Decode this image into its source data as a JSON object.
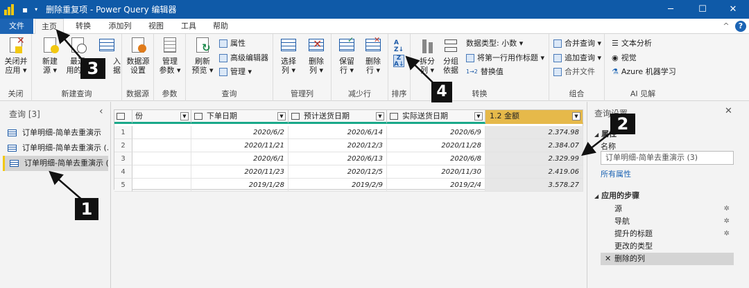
{
  "window": {
    "title": "删除重复项 - Power Query 编辑器",
    "minimize": "─",
    "maximize": "☐",
    "close": "✕"
  },
  "tabs": [
    "文件",
    "主页",
    "转换",
    "添加列",
    "视图",
    "工具",
    "帮助"
  ],
  "ribbon": {
    "close_group": {
      "label": "关闭",
      "btn": "关闭并\n应用 ▾"
    },
    "newquery_group": {
      "label": "新建查询",
      "new_source": "新建\n源 ▾",
      "recent": "最近\n用的源",
      "enter": "入\n据"
    },
    "datasource_group": {
      "label": "数据源",
      "btn": "数据源\n设置"
    },
    "params_group": {
      "label": "参数",
      "btn": "管理\n参数 ▾"
    },
    "query_group": {
      "label": "查询",
      "refresh": "刷新\n预览 ▾",
      "properties": "属性",
      "advanced": "高级编辑器",
      "manage": "管理 ▾"
    },
    "managecols_group": {
      "label": "管理列",
      "choose": "选择\n列 ▾",
      "remove": "删除\n列 ▾"
    },
    "reducerows_group": {
      "label": "减少行",
      "keep": "保留\n行 ▾",
      "remove": "删除\n行 ▾"
    },
    "sort_group": {
      "label": "排序"
    },
    "transform_group": {
      "label": "转换",
      "split": "拆分\n列 ▾",
      "groupby": "分组\n依据",
      "datatype": "数据类型: 小数 ▾",
      "first_row": "将第一行用作标题 ▾",
      "replace": "替换值"
    },
    "combine_group": {
      "label": "组合",
      "merge": "合并查询 ▾",
      "append": "追加查询 ▾",
      "merge_files": "合并文件"
    },
    "ai_group": {
      "label": "AI 见解",
      "text": "文本分析",
      "vision": "视觉",
      "azure": "Azure 机器学习"
    }
  },
  "left_pane": {
    "title": "查询 [3]",
    "collapse": "‹",
    "queries": [
      "订单明细-简单去重演示",
      "订单明细-简单去重演示 (...",
      "订单明细-简单去重演示 (..."
    ]
  },
  "grid": {
    "columns": [
      "份",
      "下单日期",
      "预计送货日期",
      "实际送货日期",
      "1.2  金额"
    ],
    "rows": [
      {
        "n": "1",
        "d1": "2020/6/2",
        "d2": "2020/6/14",
        "d3": "2020/6/9",
        "amt": "2.374.98"
      },
      {
        "n": "2",
        "d1": "2020/11/21",
        "d2": "2020/12/3",
        "d3": "2020/11/28",
        "amt": "2.384.07"
      },
      {
        "n": "3",
        "d1": "2020/6/1",
        "d2": "2020/6/13",
        "d3": "2020/6/8",
        "amt": "2.329.99"
      },
      {
        "n": "4",
        "d1": "2020/11/23",
        "d2": "2020/12/5",
        "d3": "2020/11/30",
        "amt": "2.419.06"
      },
      {
        "n": "5",
        "d1": "2019/1/28",
        "d2": "2019/2/9",
        "d3": "2019/2/4",
        "amt": "3.578.27"
      }
    ]
  },
  "right_pane": {
    "title": "查询设置",
    "close": "✕",
    "props_title": "属性",
    "name_label": "名称",
    "name_value": "订单明细-简单去重演示 (3)",
    "all_props": "所有属性",
    "steps_title": "应用的步骤",
    "steps": [
      "源",
      "导航",
      "提升的标题",
      "更改的类型",
      "删除的列"
    ]
  },
  "callouts": [
    "1",
    "2",
    "3",
    "4"
  ],
  "colors": {
    "titlebar": "#0f5aa8",
    "file_tab": "#1c64b4",
    "accent": "#f2c811",
    "money_header": "#e6b94a",
    "header_line": "#19a889"
  }
}
